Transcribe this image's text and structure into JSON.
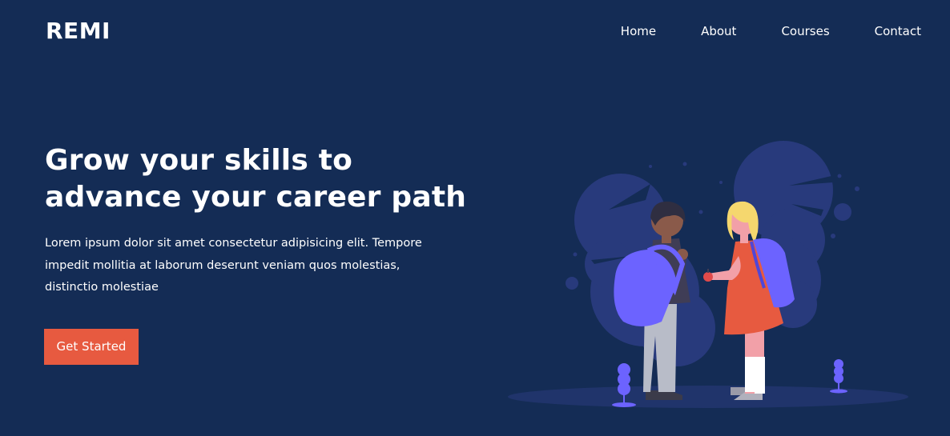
{
  "brand": {
    "name": "REMI"
  },
  "nav": {
    "items": [
      {
        "label": "Home"
      },
      {
        "label": "About"
      },
      {
        "label": "Courses"
      },
      {
        "label": "Contact"
      }
    ]
  },
  "hero": {
    "title_line1": "Grow your skills to",
    "title_line2": "advance your career path",
    "description": "Lorem ipsum dolor sit amet consectetur adipisicing elit. Tempore impedit mollitia at laborum deserunt veniam quos molestias, distinctio molestiae",
    "cta_label": "Get Started"
  },
  "colors": {
    "background": "#142c55",
    "accent": "#e75a40",
    "bush": "#283a7c",
    "backpack": "#6c63ff"
  },
  "illustration": {
    "name": "students-illustration"
  }
}
